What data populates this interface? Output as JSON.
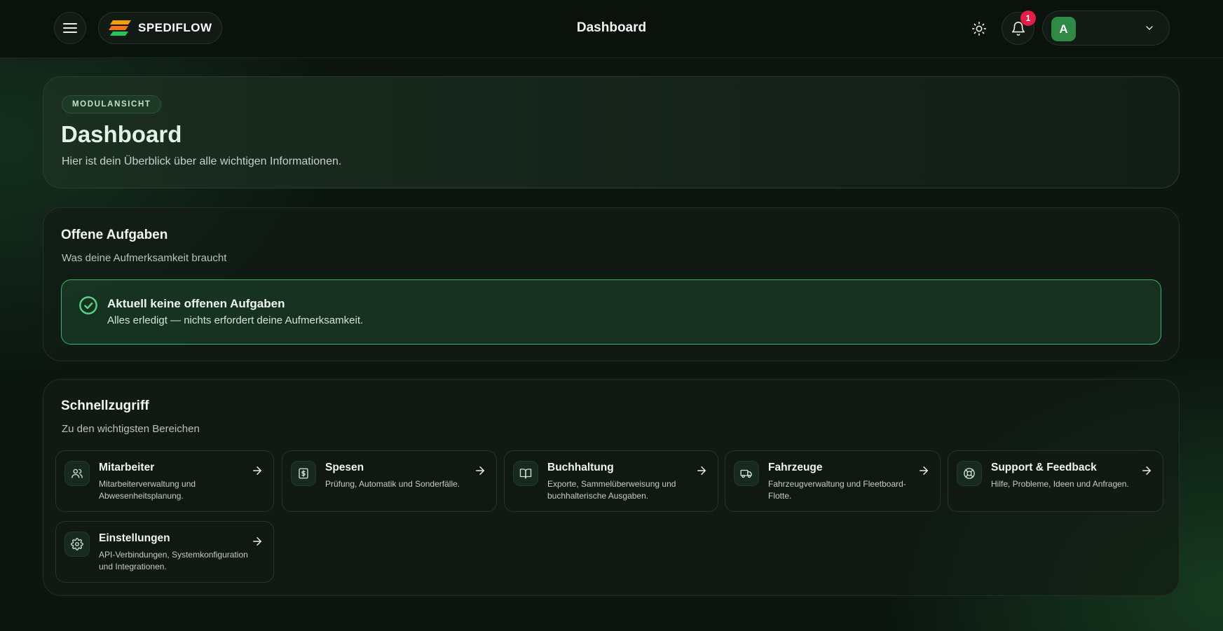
{
  "header": {
    "title": "Dashboard",
    "logo_text": "SPEDIFLOW",
    "notification_count": "1",
    "user_initial": "A"
  },
  "hero": {
    "chip": "MODULANSICHT",
    "title": "Dashboard",
    "subtitle": "Hier ist dein Überblick über alle wichtigen Informationen."
  },
  "tasks": {
    "title": "Offene Aufgaben",
    "subtitle": "Was deine Aufmerksamkeit braucht",
    "empty_title": "Aktuell keine offenen Aufgaben",
    "empty_subtitle": "Alles erledigt — nichts erfordert deine Aufmerksamkeit."
  },
  "quick": {
    "title": "Schnellzugriff",
    "subtitle": "Zu den wichtigsten Bereichen",
    "tiles": [
      {
        "title": "Mitarbeiter",
        "desc": "Mitarbeiterverwaltung und Abwesenheitsplanung.",
        "icon": "users-icon"
      },
      {
        "title": "Spesen",
        "desc": "Prüfung, Automatik und Sonderfälle.",
        "icon": "receipt-icon"
      },
      {
        "title": "Buchhaltung",
        "desc": "Exporte, Sammelüberweisung und buchhalterische Ausgaben.",
        "icon": "book-icon"
      },
      {
        "title": "Fahrzeuge",
        "desc": "Fahrzeugverwaltung und Fleetboard-Flotte.",
        "icon": "truck-icon"
      },
      {
        "title": "Support & Feedback",
        "desc": "Hilfe, Probleme, Ideen und Anfragen.",
        "icon": "lifebuoy-icon"
      },
      {
        "title": "Einstellungen",
        "desc": "API-Verbindungen, Systemkonfiguration und Integrationen.",
        "icon": "gear-icon"
      }
    ]
  },
  "colors": {
    "accent": "#3fb36a",
    "badge": "#e11d48",
    "background": "#0c1510"
  }
}
